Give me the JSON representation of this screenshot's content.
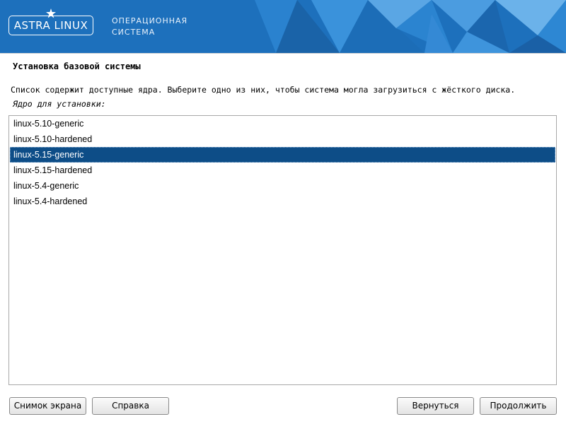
{
  "header": {
    "logo_text": "ASTRA LINUX",
    "tagline_line1": "ОПЕРАЦИОННАЯ",
    "tagline_line2": "СИСТЕМА",
    "brand_color": "#1e73c0"
  },
  "page": {
    "title": "Установка базовой системы",
    "description": "Список содержит доступные ядра. Выберите одно из них, чтобы система могла загрузиться с жёсткого диска.",
    "prompt": "Ядро для установки:"
  },
  "kernels": {
    "selected": "linux-5.15-generic",
    "items": [
      {
        "label": "linux-5.10-generic"
      },
      {
        "label": "linux-5.10-hardened"
      },
      {
        "label": "linux-5.15-generic"
      },
      {
        "label": "linux-5.15-hardened"
      },
      {
        "label": "linux-5.4-generic"
      },
      {
        "label": "linux-5.4-hardened"
      }
    ],
    "selection_color": "#0d4d87"
  },
  "buttons": {
    "screenshot": "Снимок экрана",
    "help": "Справка",
    "back": "Вернуться",
    "continue": "Продолжить"
  }
}
